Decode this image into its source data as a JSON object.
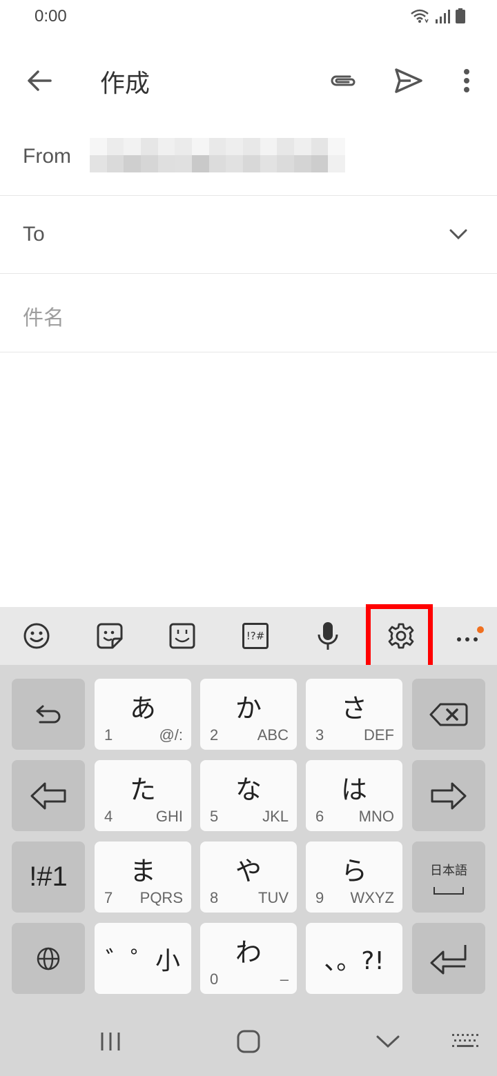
{
  "status": {
    "time": "0:00"
  },
  "app": {
    "title": "作成"
  },
  "fields": {
    "from_label": "From",
    "to_label": "To",
    "subject_placeholder": "件名"
  },
  "keyboard": {
    "toolbar": [
      "emoji-icon",
      "sticker-icon",
      "kaomoji-icon",
      "symbols-icon",
      "microphone-icon",
      "settings-icon",
      "more-icon"
    ],
    "toolbar_symbols_label": "!?#",
    "keys": {
      "a": {
        "main": "あ",
        "num": "1",
        "letters": "@/:"
      },
      "ka": {
        "main": "か",
        "num": "2",
        "letters": "ABC"
      },
      "sa": {
        "main": "さ",
        "num": "3",
        "letters": "DEF"
      },
      "ta": {
        "main": "た",
        "num": "4",
        "letters": "GHI"
      },
      "na": {
        "main": "な",
        "num": "5",
        "letters": "JKL"
      },
      "ha": {
        "main": "は",
        "num": "6",
        "letters": "MNO"
      },
      "ma": {
        "main": "ま",
        "num": "7",
        "letters": "PQRS"
      },
      "ya": {
        "main": "や",
        "num": "8",
        "letters": "TUV"
      },
      "ra": {
        "main": "ら",
        "num": "9",
        "letters": "WXYZ"
      },
      "dakuten": {
        "main": "゛゜小"
      },
      "wa": {
        "main": "わ",
        "num": "0",
        "letters": "–"
      },
      "punct": {
        "main": "、。?!"
      },
      "symbols": {
        "main": "!#1"
      },
      "lang": {
        "main": "日本語"
      }
    }
  }
}
